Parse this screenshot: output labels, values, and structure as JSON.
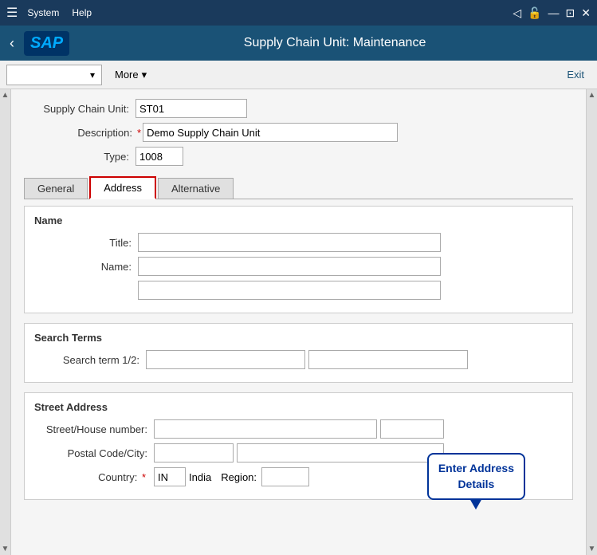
{
  "titlebar": {
    "menu_items": [
      "System",
      "Help"
    ],
    "hamburger": "☰",
    "controls": [
      "◁",
      "⊟",
      "⊡",
      "✕"
    ]
  },
  "header": {
    "back_label": "‹",
    "sap_logo": "SAP",
    "title": "Supply Chain Unit: Maintenance"
  },
  "toolbar": {
    "dropdown_placeholder": "",
    "more_label": "More",
    "more_arrow": "▾",
    "exit_label": "Exit"
  },
  "form": {
    "supply_chain_unit_label": "Supply Chain Unit:",
    "supply_chain_unit_value": "ST01",
    "description_label": "Description:",
    "description_required": "*",
    "description_value": "Demo Supply Chain Unit",
    "type_label": "Type:",
    "type_value": "1008"
  },
  "tabs": [
    {
      "label": "General",
      "active": false
    },
    {
      "label": "Address",
      "active": true
    },
    {
      "label": "Alternative",
      "active": false
    }
  ],
  "address_tab": {
    "name_section": {
      "title": "Name",
      "title_label": "Title:",
      "title_value": "",
      "name_label": "Name:",
      "name_value": "",
      "name2_value": ""
    },
    "callout": {
      "line1": "Enter Address",
      "line2": "Details"
    },
    "search_terms_section": {
      "title": "Search Terms",
      "search_term_label": "Search term 1/2:",
      "search_term1_value": "",
      "search_term2_value": ""
    },
    "street_address_section": {
      "title": "Street Address",
      "street_house_label": "Street/House number:",
      "street_value": "",
      "house_value": "",
      "postal_city_label": "Postal Code/City:",
      "postal_value": "",
      "city_value": "",
      "country_label": "Country:",
      "country_required": "*",
      "country_code": "IN",
      "country_name": "India",
      "region_label": "Region:",
      "region_value": ""
    }
  }
}
